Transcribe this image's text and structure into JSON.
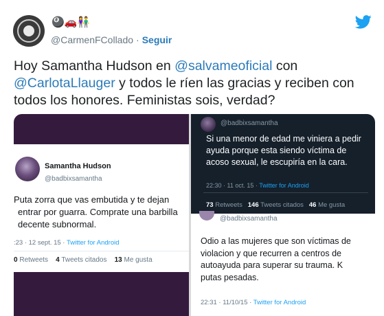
{
  "header": {
    "display_name": "🎱🚗👫",
    "handle": "@CarmenFCollado",
    "separator": "·",
    "follow_label": "Seguir"
  },
  "tweet": {
    "text_1": "Hoy Samantha Hudson en ",
    "mention_1": "@salvameoficial",
    "text_2": " con ",
    "mention_2": "@CarlotaLlauger",
    "text_3": " y todos le ríen las gracias y reciben con todos los honores. Feministas sois, verdad?"
  },
  "media": {
    "left_card": {
      "name": "Samantha Hudson",
      "handle": "@badbixsamantha",
      "text": "Puta zorra que vas embutida y te dejan entrar por guarra. Comprate una barbilla decente subnormal.",
      "time": ":23 · 12 sept. 15 · ",
      "source": "Twitter for Android",
      "retweets_count": "0",
      "retweets_label": "Retweets",
      "quotes_count": "4",
      "quotes_label": "Tweets citados",
      "likes_count": "13",
      "likes_label": "Me gusta"
    },
    "dark_card": {
      "handle": "@badbixsamantha",
      "text": "Si una menor de edad me viniera a pedir ayuda porque esta siendo víctima de acoso sexual, le escupiría en la cara.",
      "time": "22:30 · 11 oct. 15 · ",
      "source": "Twitter for Android",
      "retweets_count": "73",
      "retweets_label": "Retweets",
      "quotes_count": "146",
      "quotes_label": "Tweets citados",
      "likes_count": "46",
      "likes_label": "Me gusta"
    },
    "bottom_card": {
      "handle": "@badbixsamantha",
      "text": "Odio a las mujeres que son víctimas de violacion y que recurren a centros de autoayuda para superar su trauma. K putas pesadas.",
      "time": "22:31 · 11/10/15 · ",
      "source": "Twitter for Android"
    }
  },
  "colors": {
    "link_blue": "#2b7bb9",
    "twitter_blue": "#1da1f2",
    "left_background": "#341b3e",
    "dark_card_background": "#15202b"
  },
  "icons": {
    "logo": "twitter-bird-icon"
  }
}
